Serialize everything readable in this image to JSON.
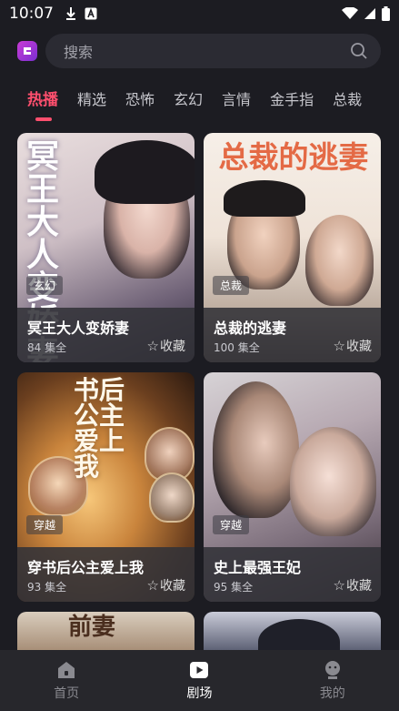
{
  "status_bar": {
    "time": "10:07"
  },
  "search": {
    "placeholder": "搜索"
  },
  "tabs": [
    {
      "label": "热播",
      "active": true
    },
    {
      "label": "精选"
    },
    {
      "label": "恐怖"
    },
    {
      "label": "玄幻"
    },
    {
      "label": "言情"
    },
    {
      "label": "金手指"
    },
    {
      "label": "总裁"
    }
  ],
  "cards": [
    {
      "title": "冥王大人变娇妻",
      "episodes": "84 集全",
      "genre": "玄幻",
      "fav_label": "收藏",
      "poster_text": "冥王大人变娇妻"
    },
    {
      "title": "总裁的逃妻",
      "episodes": "100 集全",
      "genre": "总裁",
      "fav_label": "收藏",
      "poster_text": "总裁的逃妻"
    },
    {
      "title": "穿书后公主爱上我",
      "episodes": "93 集全",
      "genre": "穿越",
      "fav_label": "收藏",
      "poster_text": "书后公主爱上我"
    },
    {
      "title": "史上最强王妃",
      "episodes": "95 集全",
      "genre": "穿越",
      "fav_label": "收藏",
      "poster_text": ""
    }
  ],
  "partial_cards": [
    {
      "poster_text": "前妻"
    },
    {
      "poster_text": ""
    }
  ],
  "bottom_nav": [
    {
      "label": "首页",
      "icon": "home-icon"
    },
    {
      "label": "剧场",
      "icon": "play-icon",
      "active": true
    },
    {
      "label": "我的",
      "icon": "profile-icon"
    }
  ],
  "colors": {
    "accent": "#ff4f6e",
    "background": "#1c1c22",
    "nav_bg": "#27272c"
  }
}
